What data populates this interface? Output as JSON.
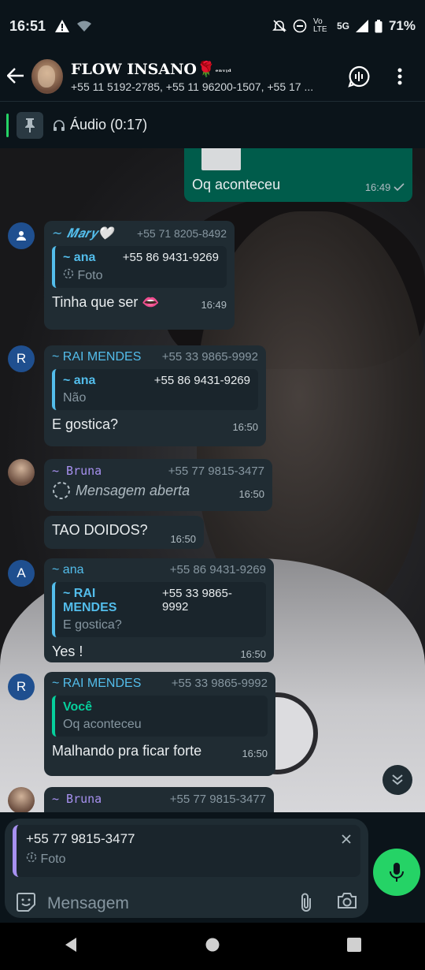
{
  "status_bar": {
    "time": "16:51",
    "network": "5G",
    "lte": "Vo LTE",
    "battery": "71%"
  },
  "header": {
    "title": "FLOW INSANO🌹",
    "title_suffix": "ᵉⁿᵛᵎᵈ",
    "subtitle": "+55 11 5192-2785, +55 11 96200-1507, +55 17 ..."
  },
  "pinned": {
    "label": "Áudio (0:17)"
  },
  "messages": [
    {
      "direction": "out",
      "text": "Oq aconteceu",
      "time": "16:49"
    },
    {
      "sender": "~ 𝑴𝒂𝒓𝒚🤍",
      "sender_color": "#53bdeb",
      "phone": "+55 71 8205-8492",
      "quote_name": "~ ana",
      "quote_phone": "+55 86 9431-9269",
      "quote_text": "Foto",
      "text": "Tinha que ser 👄",
      "time": "16:49"
    },
    {
      "sender": "~ RAI MENDES",
      "sender_color": "#53bdeb",
      "avatar_letter": "R",
      "phone": "+55 33 9865-9992",
      "quote_name": "~ ana",
      "quote_phone": "+55 86 9431-9269",
      "quote_text": "Não",
      "text": "E gostica?",
      "time": "16:50"
    },
    {
      "sender": "~ 𝙱𝚛𝚞𝚗𝚊",
      "sender_color": "#a791f0",
      "phone": "+55 77 9815-3477",
      "text": "Mensagem aberta",
      "time": "16:50"
    },
    {
      "text": "TAO DOIDOS?",
      "time": "16:50"
    },
    {
      "sender": "~ ana",
      "sender_color": "#53bdeb",
      "avatar_letter": "A",
      "phone": "+55 86 9431-9269",
      "quote_name": "~ RAI MENDES",
      "quote_phone": "+55 33 9865-9992",
      "quote_text": "E gostica?",
      "text": "Yes !",
      "time": "16:50"
    },
    {
      "sender": "~ RAI MENDES",
      "sender_color": "#53bdeb",
      "avatar_letter": "R",
      "phone": "+55 33 9865-9992",
      "quote_name": "Você",
      "quote_text": "Oq aconteceu",
      "text": "Malhando pra ficar forte",
      "time": "16:50"
    },
    {
      "sender": "~ 𝙱𝚛𝚞𝚗𝚊",
      "sender_color": "#a791f0",
      "phone": "+55 77 9815-3477"
    }
  ],
  "composer": {
    "reply_phone": "+55 77 9815-3477",
    "reply_type": "Foto",
    "placeholder": "Mensagem"
  },
  "colors": {
    "background": "#0b141a",
    "incoming_bubble": "#202c33",
    "outgoing_bubble": "#005c4b",
    "accent_green": "#25d366",
    "quote_you": "#06cf9c"
  }
}
